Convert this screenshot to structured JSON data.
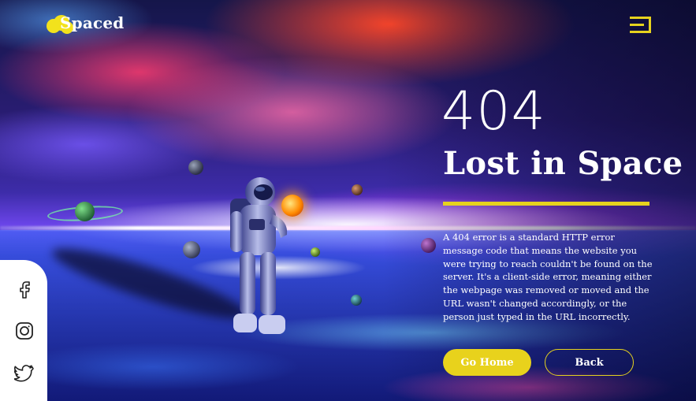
{
  "brand": {
    "name": "Spaced",
    "accent_color": "#e6d21e"
  },
  "header": {
    "menu_icon": "menu-icon"
  },
  "hero": {
    "code": "404",
    "title": "Lost in Space",
    "description": "A 404 error is a standard HTTP error message code that means the website you were trying to reach couldn't be found on the server. It's a client-side error, meaning either the webpage was removed or moved and the URL wasn't changed accordingly, or the person just typed in the URL incorrectly."
  },
  "actions": {
    "home_label": "Go Home",
    "back_label": "Back"
  },
  "social": {
    "items": [
      {
        "icon": "facebook-icon"
      },
      {
        "icon": "instagram-icon"
      },
      {
        "icon": "twitter-icon"
      }
    ]
  }
}
